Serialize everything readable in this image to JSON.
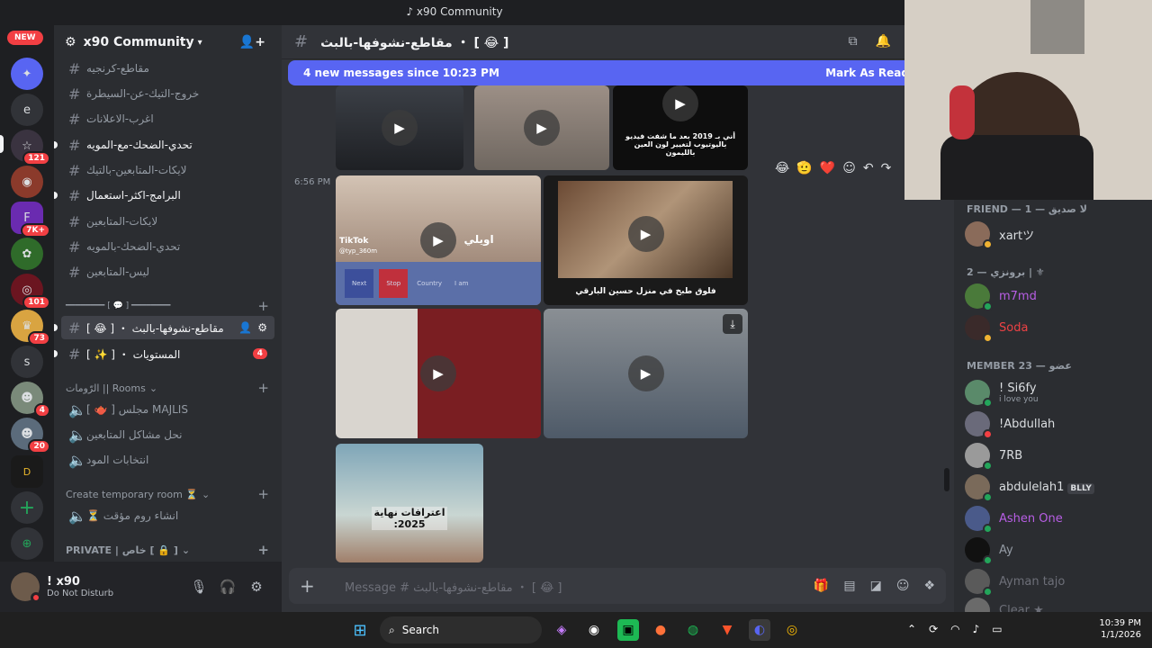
{
  "window": {
    "title": "x90 Community"
  },
  "guilds": [
    {
      "label": "",
      "badge": ""
    },
    {
      "label": "",
      "badge": ""
    },
    {
      "label": "e",
      "badge": ""
    },
    {
      "label": "",
      "badge": "121"
    },
    {
      "label": "",
      "badge": ""
    },
    {
      "label": "",
      "badge": "7K+"
    },
    {
      "label": "",
      "badge": ""
    },
    {
      "label": "",
      "badge": "101"
    },
    {
      "label": "",
      "badge": "73"
    },
    {
      "label": "s",
      "badge": ""
    },
    {
      "label": "",
      "badge": "4"
    },
    {
      "label": "",
      "badge": "20"
    },
    {
      "label": "",
      "badge": ""
    }
  ],
  "new_badge": "NEW",
  "server": {
    "name": "x90 Community"
  },
  "channels": [
    {
      "name": "مقاطع-كرنجيه"
    },
    {
      "name": "خروج-التيك-عن-السيطرة"
    },
    {
      "name": "اغرب-الاعلانات"
    },
    {
      "name": "تحدي-الضحك-مع-المويه"
    },
    {
      "name": "لايكات-المتابعين-بالتيك"
    },
    {
      "name": "البرامج-اكثر-استعمال"
    },
    {
      "name": "لايكات-المتابعين"
    },
    {
      "name": "تحدي-الضحك-بالمويه"
    },
    {
      "name": "ليس-المتابعين"
    }
  ],
  "category_line": "━━━━━━━━ [ 💬 ] ━━━━━━━━",
  "active_channel": {
    "name": "مقاطع-نشوفها-بالبث ・ [ 😂 ]"
  },
  "channel2": {
    "name": "المستويات ・ [ ✨ ]",
    "badge": "4"
  },
  "rooms_category": "الرّومات || Rooms",
  "voice": [
    {
      "name": "MAJLIS مجلس [ 🫖 ]"
    },
    {
      "name": "نحل مشاكل المتابعين"
    },
    {
      "name": "انتخابات المود"
    }
  ],
  "temp_category": "Create temporary room ⏳",
  "temp_voice": {
    "name": "انشاء روم مؤقت ⏳"
  },
  "private_category": "PRIVATE | خاص [ 🔒 ]",
  "user": {
    "name": "! x90",
    "status": "Do Not Disturb"
  },
  "header": {
    "channel": "مقاطع-نشوفها-بالبث ・ [ 😂 ]"
  },
  "newbar": {
    "text": "4 new messages since 10:23 PM",
    "action": "Mark As Read"
  },
  "message": {
    "time": "6:56 PM"
  },
  "captions": {
    "v3": "أني بـ 2019 بعد ما شفت فيديو باليوتيوب لتغيير لون العين بالليمون",
    "v4": "اويلي",
    "v5": "فلوق طبخ في منزل حسين البارقي",
    "v8": "اعترافات نهاية 2025:",
    "tiktok": "TikTok",
    "tiktok_user": "@typ_360m",
    "next": "Next",
    "stop": "Stop",
    "country": "Country",
    "iam": "I am"
  },
  "composer": {
    "placeholder": "Message # مقاطع-نشوفها-بالبث ・ [ 😂 ]"
  },
  "members": {
    "friend_header": "FRIEND — لا صديق — 1",
    "role2_header": "برونزي — 2 | ⚜",
    "member_header": "MEMBER 23 — عضو",
    "list": [
      {
        "name": "xartツ",
        "sub": "",
        "tag": ""
      },
      {
        "name": "m7md",
        "sub": "",
        "tag": ""
      },
      {
        "name": "Soda",
        "sub": "",
        "tag": ""
      },
      {
        "name": "! Si6fy",
        "sub": "i love you",
        "tag": ""
      },
      {
        "name": "!Abdullah",
        "sub": "",
        "tag": ""
      },
      {
        "name": "7RB",
        "sub": "",
        "tag": ""
      },
      {
        "name": "abdulelah1",
        "sub": "",
        "tag": "BLLY"
      },
      {
        "name": "Ashen One",
        "sub": "",
        "tag": ""
      },
      {
        "name": "Ay",
        "sub": "",
        "tag": ""
      },
      {
        "name": "Ayman tajo",
        "sub": "",
        "tag": ""
      },
      {
        "name": "Clear ★",
        "sub": "",
        "tag": ""
      }
    ]
  },
  "taskbar": {
    "search": "Search",
    "time": "10:39 PM",
    "date": "1/1/2026"
  },
  "colors": {
    "blurple": "#5865f2",
    "red": "#f23f43",
    "green": "#23a55a",
    "purple": "#b85ee5",
    "soda": "#ed4245"
  }
}
